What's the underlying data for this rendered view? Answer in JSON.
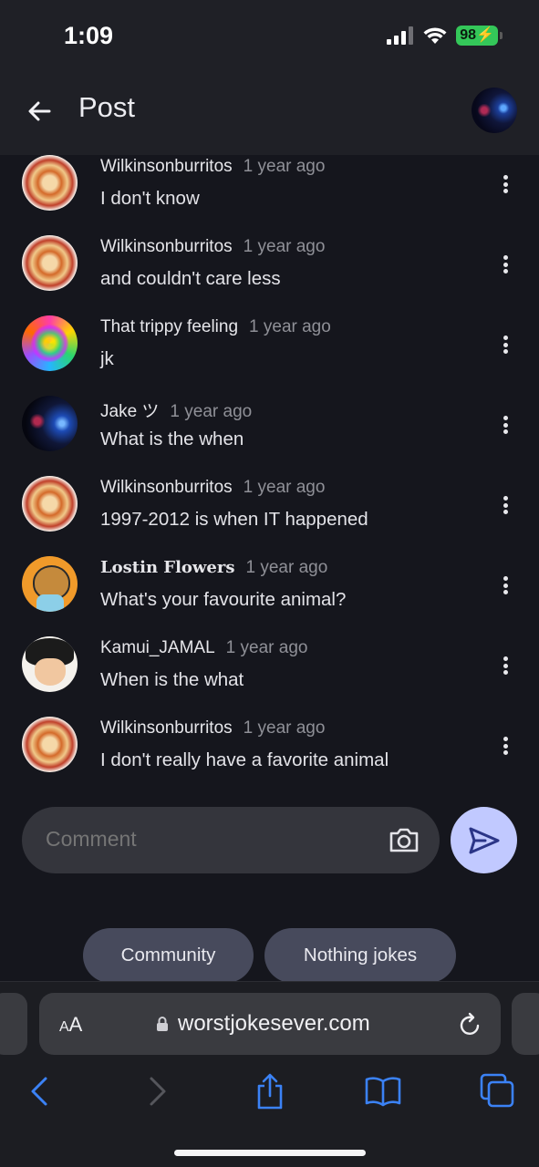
{
  "status_bar": {
    "time": "1:09",
    "battery": "98"
  },
  "header": {
    "title": "Post"
  },
  "comments": [
    {
      "user": "Wilkinsonburritos",
      "time": "1 year ago",
      "text": "I don't know",
      "avatar": "burrito-avatar"
    },
    {
      "user": "Wilkinsonburritos",
      "time": "1 year ago",
      "text": "and couldn't care less",
      "avatar": "burrito-avatar"
    },
    {
      "user": "That trippy feeling",
      "time": "1 year ago",
      "text": "jk",
      "avatar": "trippy-avatar"
    },
    {
      "user": "Jake ツ",
      "time": "1 year ago",
      "text": "What is the when",
      "avatar": "jake-avatar"
    },
    {
      "user": "Wilkinsonburritos",
      "time": "1 year ago",
      "text": "1997-2012 is when IT happened",
      "avatar": "burrito-avatar"
    },
    {
      "user": "Lostin Flowers",
      "time": "1 year ago",
      "text": "What's your favourite animal?",
      "avatar": "cat-avatar"
    },
    {
      "user": "Kamui_JAMAL",
      "time": "1 year ago",
      "text": "When is the what",
      "avatar": "anime-avatar"
    },
    {
      "user": "Wilkinsonburritos",
      "time": "1 year ago",
      "text": "I don't really have a favorite animal",
      "avatar": "burrito-avatar"
    }
  ],
  "composer": {
    "placeholder": "Comment"
  },
  "chips": [
    {
      "label": "Community"
    },
    {
      "label": "Nothing jokes"
    }
  ],
  "browser": {
    "aa_label": "AA",
    "url": "worstjokesever.com"
  },
  "colors": {
    "background": "#15161d",
    "header": "#1f2026",
    "send_button": "#c1c9ff",
    "chip": "#474a5c",
    "battery": "#34c759",
    "link_blue": "#3b82f6"
  }
}
